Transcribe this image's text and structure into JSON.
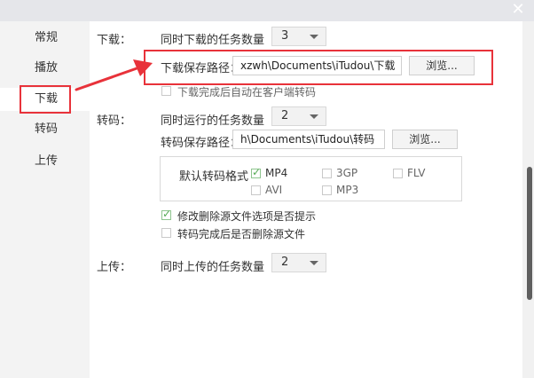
{
  "window": {
    "close_glyph": "✕"
  },
  "sidebar": {
    "items": [
      {
        "label": "常规"
      },
      {
        "label": "播放"
      },
      {
        "label": "下载"
      },
      {
        "label": "转码"
      },
      {
        "label": "上传"
      }
    ],
    "active": "下载"
  },
  "download": {
    "section": "下载：",
    "concurrent_label": "同时下载的任务数量",
    "concurrent_value": "3",
    "path_label": "下载保存路径：",
    "path_value": "xzwh\\Documents\\iTudou\\下载",
    "browse": "浏览...",
    "auto_transcode_label": "下载完成后自动在客户端转码",
    "auto_transcode_checked": false
  },
  "transcode": {
    "section": "转码：",
    "concurrent_label": "同时运行的任务数量",
    "concurrent_value": "2",
    "path_label": "转码保存路径：",
    "path_value": "h\\Documents\\iTudou\\转码",
    "browse": "浏览...",
    "format_label": "默认转码格式",
    "formats": [
      {
        "label": "MP4",
        "checked": true
      },
      {
        "label": "3GP",
        "checked": false
      },
      {
        "label": "FLV",
        "checked": false
      },
      {
        "label": "AVI",
        "checked": false
      },
      {
        "label": "MP3",
        "checked": false
      }
    ],
    "prompt_label": "修改删除源文件选项是否提示",
    "prompt_checked": true,
    "delete_label": "转码完成后是否删除源文件",
    "delete_checked": false
  },
  "upload": {
    "section": "上传：",
    "concurrent_label": "同时上传的任务数量",
    "concurrent_value": "2"
  },
  "colors": {
    "annotation_red": "#e8323a",
    "check_green": "#55aa55"
  }
}
